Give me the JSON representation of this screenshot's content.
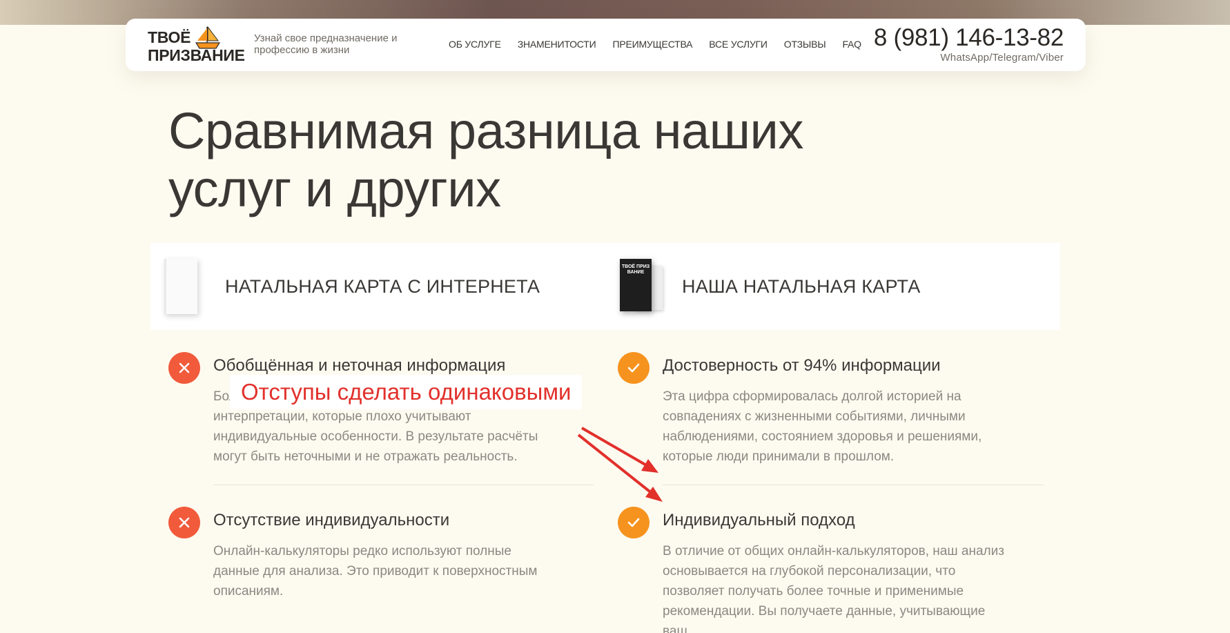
{
  "header": {
    "logo": {
      "line1": "ТВОЁ",
      "line2": "ПРИЗВАНИЕ"
    },
    "tagline": "Узнай свое предназначение и профессию в жизни",
    "nav": [
      {
        "label": "ОБ УСЛУГЕ"
      },
      {
        "label": "ЗНАМЕНИТОСТИ"
      },
      {
        "label": "ПРЕИМУЩЕСТВА"
      },
      {
        "label": "ВСЕ УСЛУГИ"
      },
      {
        "label": "ОТЗЫВЫ"
      },
      {
        "label": "FAQ"
      }
    ],
    "phone": "8 (981) 146-13-82",
    "messengers": "WhatsApp/Telegram/Viber"
  },
  "main": {
    "title_line1": "Сравнимая разница наших",
    "title_line2": "услуг и других",
    "columns": [
      {
        "label": "НАТАЛЬНАЯ КАРТА С ИНТЕРНЕТА",
        "book": "white-book"
      },
      {
        "label": "НАША НАТАЛЬНАЯ КАРТА",
        "book": "black-book",
        "book_cover_text": "ТВОЁ ПРИЗ ВАНИЕ"
      }
    ],
    "left_items": [
      {
        "icon": "cross-icon",
        "title": "Обобщённая и неточная информация",
        "text": "Большинство онлайн-сервисов используют шаблонные интерпретации, которые плохо учитывают индивидуальные особенности. В результате расчёты могут быть неточными и не отражать реальность."
      },
      {
        "icon": "cross-icon",
        "title": "Отсутствие индивидуальности",
        "text": "Онлайн-калькуляторы редко используют полные данные для анализа. Это приводит к поверхностным описаниям."
      }
    ],
    "right_items": [
      {
        "icon": "check-icon",
        "title": "Достоверность от 94% информации",
        "text": "Эта цифра сформировалась долгой историей на совпадениях с жизненными событиями, личными наблюдениями, состоянием здоровья и решениями, которые люди принимали в прошлом."
      },
      {
        "icon": "check-icon",
        "title": "Индивидуальный подход",
        "text": "В отличие от общих онлайн-калькуляторов, наш анализ основывается на глубокой персонализации, что позволяет получать более точные и применимые рекомендации. Вы получаете данные, учитывающие ваш"
      }
    ]
  },
  "annotation": {
    "text": "Отступы сделать одинаковыми",
    "color": "#e2302b"
  },
  "colors": {
    "background": "#fdfbf0",
    "cross": "#f15a3b",
    "check": "#f6931e",
    "text": "#3a3835",
    "muted": "#8c8882"
  }
}
